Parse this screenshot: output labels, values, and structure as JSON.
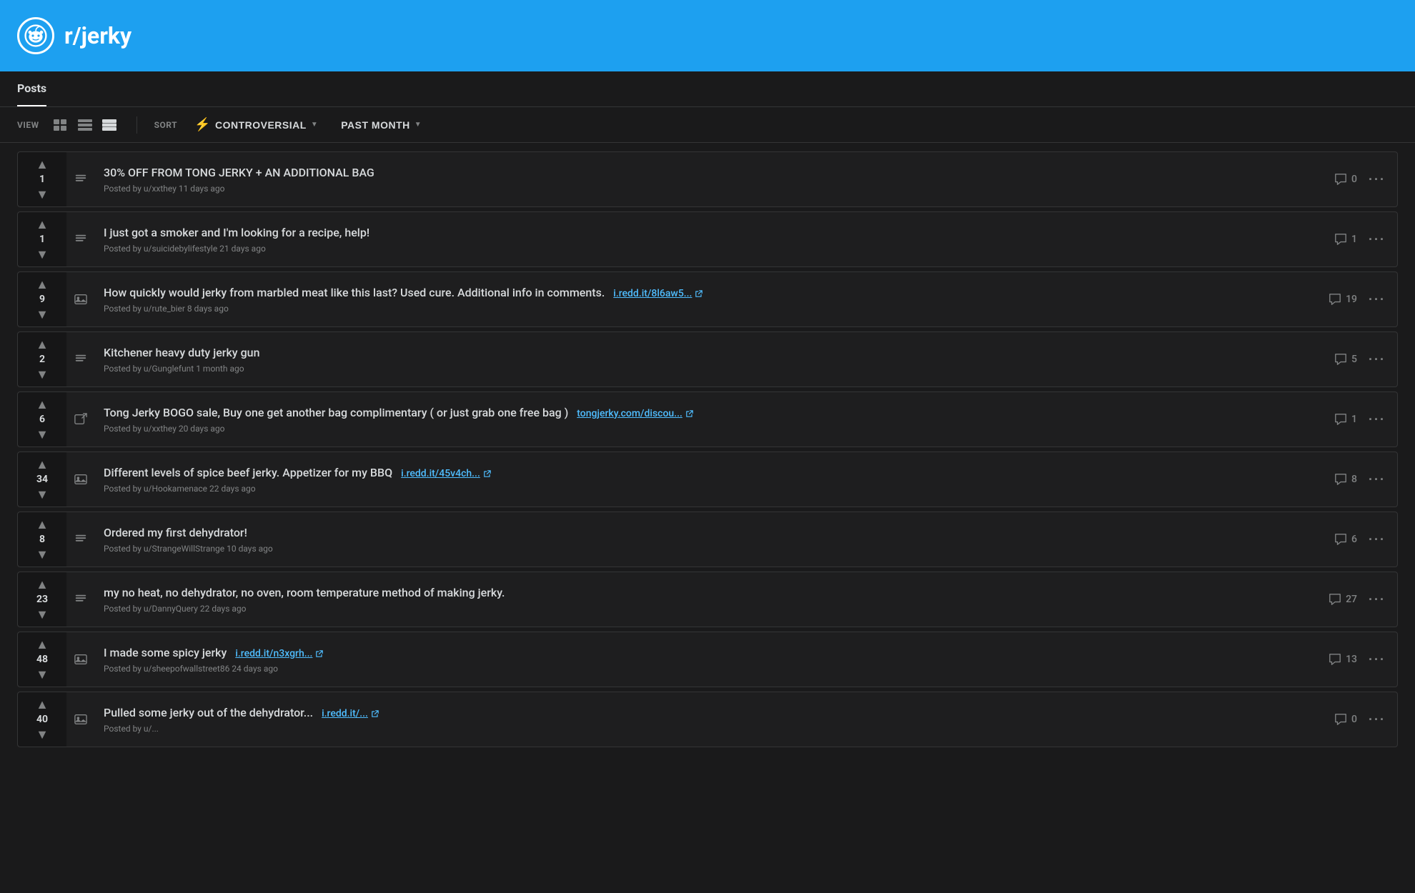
{
  "header": {
    "subreddit": "r/jerky",
    "logo_alt": "reddit-alien-icon"
  },
  "nav": {
    "tab": "Posts"
  },
  "toolbar": {
    "view_label": "VIEW",
    "sort_label": "SORT",
    "sort_option": "CONTROVERSIAL",
    "time_option": "PAST MONTH",
    "view_icons": [
      "card-view-icon",
      "compact-view-icon",
      "list-view-icon"
    ]
  },
  "posts": [
    {
      "id": 1,
      "votes": 1,
      "type": "text",
      "title": "30% OFF FROM TONG JERKY + AN ADDITIONAL BAG",
      "meta": "Posted by u/xxthey 11 days ago",
      "comments": 0,
      "has_link": false
    },
    {
      "id": 2,
      "votes": 1,
      "type": "text",
      "title": "I just got a smoker and I'm looking for a recipe, help!",
      "meta": "Posted by u/suicidebylifestyle 21 days ago",
      "comments": 1,
      "has_link": false
    },
    {
      "id": 3,
      "votes": 9,
      "type": "image",
      "title": "How quickly would jerky from marbled meat like this last? Used cure. Additional info in comments.",
      "meta": "Posted by u/rute_bier 8 days ago",
      "comments": 19,
      "has_link": true,
      "link_text": "i.redd.it/8l6aw5...",
      "link_url": "#"
    },
    {
      "id": 4,
      "votes": 2,
      "type": "text",
      "title": "Kitchener heavy duty jerky gun",
      "meta": "Posted by u/Gunglefunt 1 month ago",
      "comments": 5,
      "has_link": false
    },
    {
      "id": 5,
      "votes": 6,
      "type": "external",
      "title": "Tong Jerky BOGO sale, Buy one get another bag complimentary ( or just grab one free bag )",
      "meta": "Posted by u/xxthey 20 days ago",
      "comments": 1,
      "has_link": true,
      "link_text": "tongjerky.com/discou...",
      "link_url": "#"
    },
    {
      "id": 6,
      "votes": 34,
      "type": "image",
      "title": "Different levels of spice beef jerky. Appetizer for my BBQ",
      "meta": "Posted by u/Hookamenace 22 days ago",
      "comments": 8,
      "has_link": true,
      "link_text": "i.redd.it/45v4ch...",
      "link_url": "#"
    },
    {
      "id": 7,
      "votes": 8,
      "type": "text",
      "title": "Ordered my first dehydrator!",
      "meta": "Posted by u/StrangeWillStrange 10 days ago",
      "comments": 6,
      "has_link": false
    },
    {
      "id": 8,
      "votes": 23,
      "type": "text",
      "title": "my no heat, no dehydrator, no oven, room temperature method of making jerky.",
      "meta": "Posted by u/DannyQuery 22 days ago",
      "comments": 27,
      "has_link": false
    },
    {
      "id": 9,
      "votes": 48,
      "type": "image",
      "title": "I made some spicy jerky",
      "meta": "Posted by u/sheepofwallstreet86 24 days ago",
      "comments": 13,
      "has_link": true,
      "link_text": "i.redd.it/n3xgrh...",
      "link_url": "#"
    },
    {
      "id": 10,
      "votes": 40,
      "type": "image",
      "title": "Pulled some jerky out of the dehydrator...",
      "meta": "Posted by u/...",
      "comments": 0,
      "has_link": true,
      "link_text": "i.redd.it/...",
      "link_url": "#"
    }
  ]
}
